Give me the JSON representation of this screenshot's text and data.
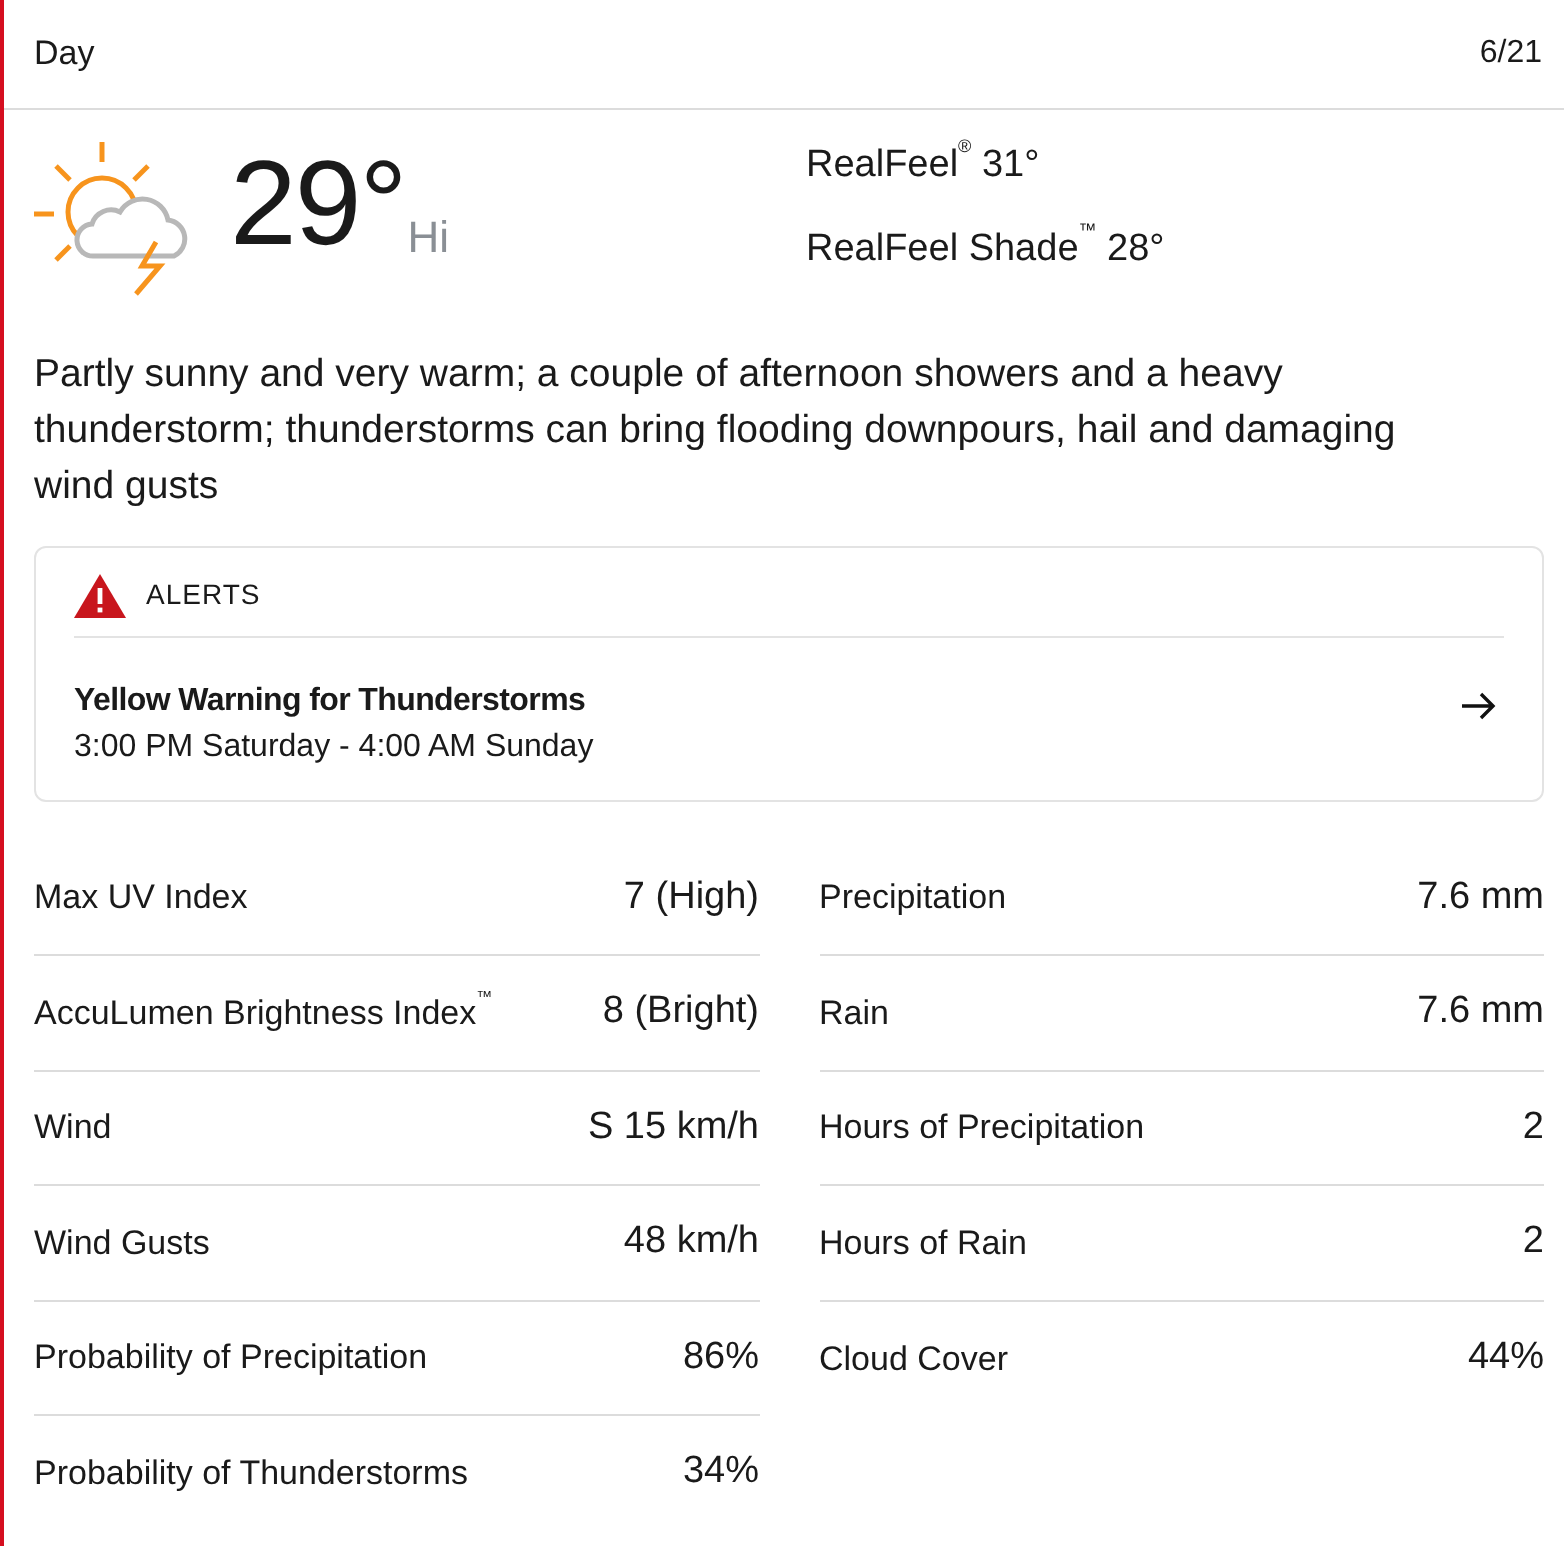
{
  "header": {
    "title": "Day",
    "date": "6/21"
  },
  "current": {
    "temperature": "29°",
    "temperature_label": "Hi",
    "realfeel": [
      {
        "text": "RealFeel$^{®}$ 31°"
      },
      {
        "text": "RealFeel Shade$^{™}$ 28°"
      }
    ]
  },
  "phrase": "Partly sunny and very warm; a couple of afternoon showers and a heavy thunderstorm; thunderstorms can bring flooding downpours, hail and damaging wind gusts",
  "alerts": {
    "heading": "ALERTS",
    "items": [
      {
        "title": "Yellow Warning for Thunderstorms",
        "time": "3:00 PM Saturday - 4:00 AM Sunday"
      }
    ]
  },
  "details": [
    {
      "rows": [
        {
          "label": "Max UV Index",
          "value": "7 (High)"
        },
        {
          "label": "AccuLumen Brightness Index$^{™}$",
          "value": "8 (Bright)"
        },
        {
          "label": "Wind",
          "value": "S 15 km/h"
        },
        {
          "label": "Wind Gusts",
          "value": "48 km/h"
        },
        {
          "label": "Probability of Precipitation",
          "value": "86%"
        },
        {
          "label": "Probability of Thunderstorms",
          "value": "34%"
        }
      ]
    },
    {
      "rows": [
        {
          "label": "Precipitation",
          "value": "7.6 mm"
        },
        {
          "label": "Rain",
          "value": "7.6 mm"
        },
        {
          "label": "Hours of Precipitation",
          "value": "2"
        },
        {
          "label": "Hours of Rain",
          "value": "2"
        },
        {
          "label": "Cloud Cover",
          "value": "44%"
        }
      ]
    }
  ]
}
